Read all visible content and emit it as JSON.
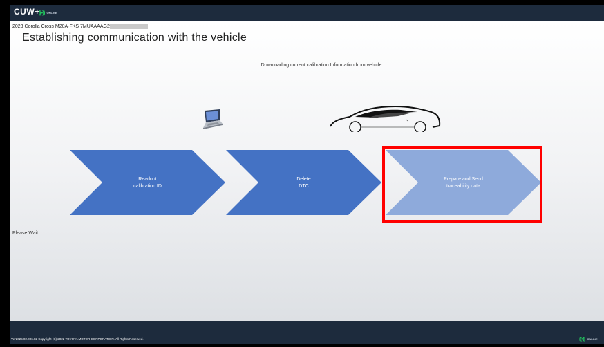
{
  "app": {
    "name": "CUW+",
    "online_label": "ONLINE"
  },
  "header": {
    "vehicle": "2023 Corolla Cross M20A-FKS 7MUAAAAG2",
    "title": "Establishing communication with the vehicle"
  },
  "status_message": "Downloading current calibration Information from vehicle.",
  "steps": [
    {
      "label": "Readout\ncalibration ID",
      "state": "done",
      "color": "#4472c4"
    },
    {
      "label": "Delete\nDTC",
      "state": "done",
      "color": "#4472c4"
    },
    {
      "label": "Prepare and Send\ntraceability data",
      "state": "active",
      "color": "#8eaadb"
    }
  ],
  "wait_text": "Please Wait...",
  "footer": {
    "copyright": "Ver2025.02.006.82  Copyright (C) 2022 TOYOTA MOTOR CORPORATION. All Rights Reserved.",
    "online_label": "ONLINE"
  },
  "colors": {
    "bar": "#1d2b3d",
    "step_done": "#4472c4",
    "step_active": "#8eaadb",
    "highlight": "#ff0000",
    "online": "#22c55e"
  }
}
